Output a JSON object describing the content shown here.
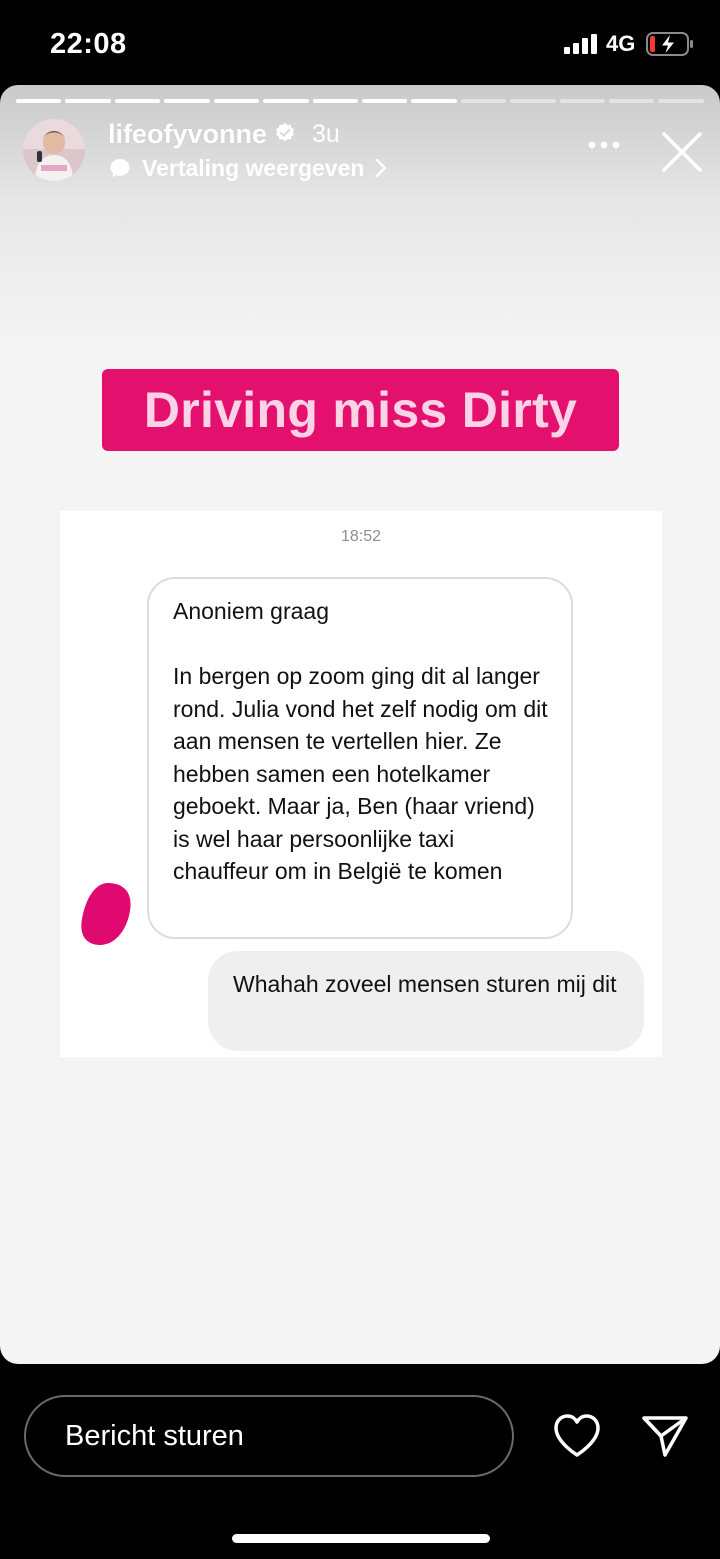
{
  "status_bar": {
    "time": "22:08",
    "network": "4G",
    "icons": [
      "signal-bars-icon",
      "battery-charging-icon"
    ]
  },
  "story": {
    "progress": {
      "segments": 14,
      "completed": 9
    },
    "header": {
      "username": "lifeofyvonne",
      "verified": true,
      "age": "3u",
      "translate_label": "Vertaling weergeven",
      "icons": [
        "verified-badge-icon",
        "speech-bubble-icon",
        "chevron-right-icon",
        "more-icon",
        "close-icon"
      ]
    },
    "title_sticker": {
      "text": "Driving miss Dirty",
      "background_color": "#e4106e",
      "text_color": "#fbd3e7"
    },
    "chat": {
      "timestamp": "18:52",
      "received_message": {
        "paragraph1": "Anoniem graag",
        "paragraph2": "In bergen op zoom ging dit al langer rond. Julia vond het zelf nodig om dit aan mensen te vertellen hier. Ze hebben samen een hotelkamer geboekt. Maar ja, Ben (haar vriend) is wel haar persoonlijke taxi chauffeur om in België te komen"
      },
      "sent_message": "Whahah zoveel mensen sturen mij dit"
    }
  },
  "bottom_bar": {
    "message_placeholder": "Bericht sturen",
    "icons": [
      "heart-icon",
      "send-icon"
    ]
  }
}
